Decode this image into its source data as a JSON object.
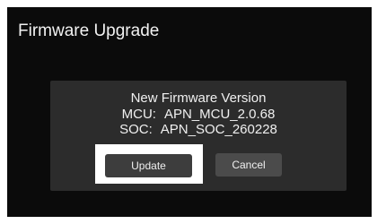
{
  "screen": {
    "title": "Firmware Upgrade"
  },
  "dialog": {
    "heading": "New Firmware Version",
    "mcu_label": "MCU:",
    "mcu_value": "APN_MCU_2.0.68",
    "soc_label": "SOC:",
    "soc_value": "APN_SOC_260228",
    "update_label": "Update",
    "cancel_label": "Cancel"
  },
  "colors": {
    "background": "#0b0b0b",
    "dialog": "#2c2c2c",
    "button": "#4b4b4b",
    "focus": "#ffffff"
  }
}
